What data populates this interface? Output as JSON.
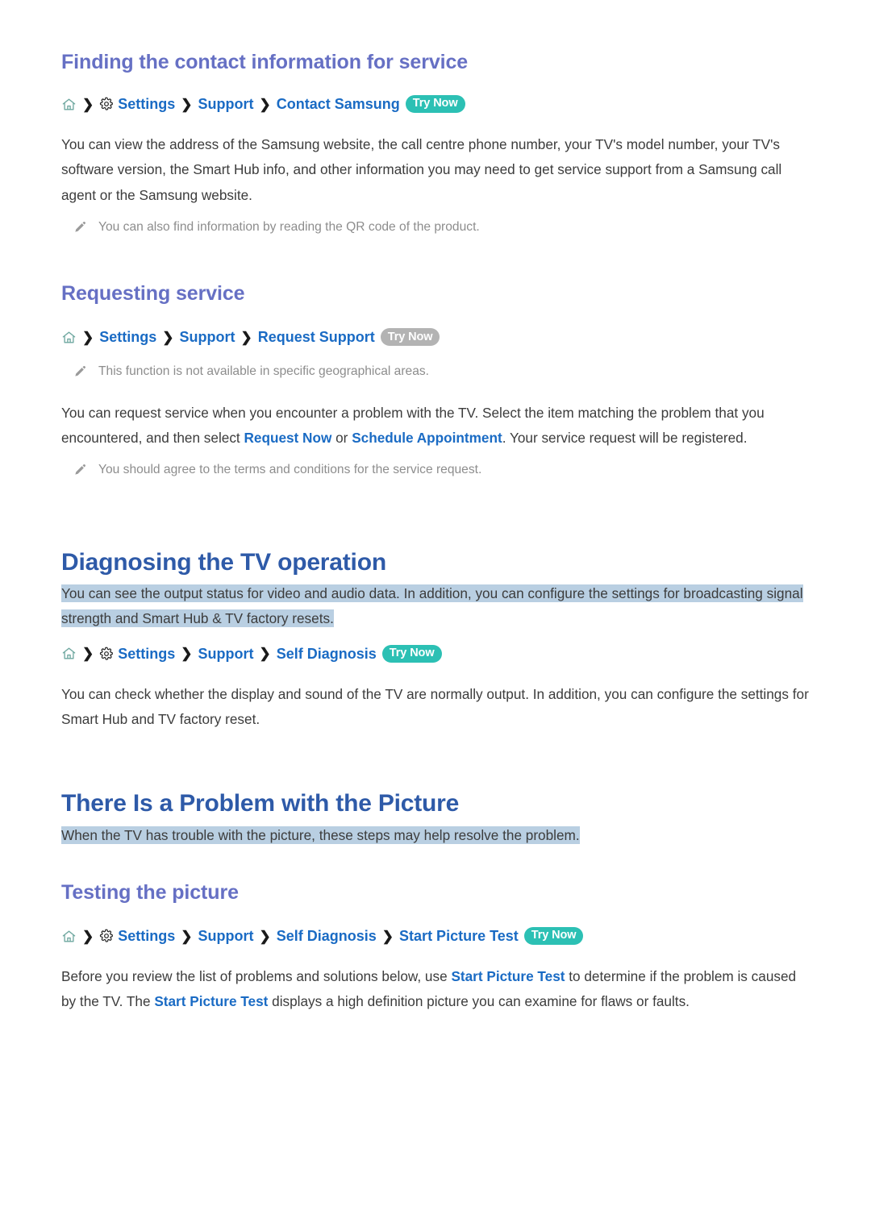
{
  "colors": {
    "h1": "#2e5aa8",
    "h2": "#6670c4",
    "link": "#1a6bc4",
    "body": "#3c3c3c",
    "note": "#8d8d8d",
    "badge_active": "#2cc0b4",
    "badge_disabled": "#b3b3b3",
    "highlight": "#b9cfe2",
    "home_icon": "#6fa8a0",
    "gear_icon": "#222222",
    "pencil_icon": "#9a9a9a",
    "page_background": "#ffffff"
  },
  "sections": [
    {
      "id": "finding-contact-information",
      "heading": "Finding the contact information for service",
      "heading_level": "h2",
      "breadcrumb": {
        "home_icon": "home-icon",
        "gear_icon": "gear-icon",
        "separator": "❯",
        "segments": [
          "Settings",
          "Support",
          "Contact Samsung"
        ],
        "badge": "Try Now",
        "badge_state": "active"
      },
      "paragraph": "You can view the address of the Samsung website, the call centre phone number, your TV's model number, your TV's software version, the Smart Hub info, and other information you may need to get service support from a Samsung call agent or the Samsung website.",
      "note": "You can also find information by reading the QR code of the product."
    },
    {
      "id": "requesting-service",
      "heading": "Requesting service",
      "heading_level": "h2",
      "breadcrumb": {
        "home_icon": "home-icon",
        "gear_icon": null,
        "separator": "❯",
        "segments": [
          "Settings",
          "Support",
          "Request Support"
        ],
        "badge": "Try Now",
        "badge_state": "disabled"
      },
      "note_top": "This function is not available in specific geographical areas.",
      "paragraph_parts": [
        {
          "text": "You can request service when you encounter a problem with the TV. Select the item matching the problem that you encountered, and then select ",
          "style": "plain"
        },
        {
          "text": "Request Now",
          "style": "link"
        },
        {
          "text": " or ",
          "style": "plain"
        },
        {
          "text": "Schedule Appointment",
          "style": "link"
        },
        {
          "text": ". Your service request will be registered.",
          "style": "plain"
        }
      ],
      "note": "You should agree to the terms and conditions for the service request."
    },
    {
      "id": "diagnosing-tv-operation",
      "heading": "Diagnosing the TV operation",
      "heading_level": "h1",
      "highlighted_paragraph": "You can see the output status for video and audio data. In addition, you can configure the settings for broadcasting signal strength and Smart Hub & TV factory resets.",
      "breadcrumb": {
        "home_icon": "home-icon",
        "gear_icon": "gear-icon",
        "separator": "❯",
        "segments": [
          "Settings",
          "Support",
          "Self Diagnosis"
        ],
        "badge": "Try Now",
        "badge_state": "active"
      },
      "paragraph": "You can check whether the display and sound of the TV are normally output. In addition, you can configure the settings for Smart Hub and TV factory reset."
    },
    {
      "id": "problem-with-the-picture",
      "heading": "There Is a Problem with the Picture",
      "heading_level": "h1",
      "highlighted_paragraph": "When the TV has trouble with the picture, these steps may help resolve the problem."
    },
    {
      "id": "testing-the-picture",
      "heading": "Testing the picture",
      "heading_level": "h2",
      "breadcrumb": {
        "home_icon": "home-icon",
        "gear_icon": "gear-icon",
        "separator": "❯",
        "segments": [
          "Settings",
          "Support",
          "Self Diagnosis",
          "Start Picture Test"
        ],
        "badge": "Try Now",
        "badge_state": "active"
      },
      "paragraph_parts": [
        {
          "text": "Before you review the list of problems and solutions below, use ",
          "style": "plain"
        },
        {
          "text": "Start Picture Test",
          "style": "link"
        },
        {
          "text": " to determine if the problem is caused by the TV. The ",
          "style": "plain"
        },
        {
          "text": "Start Picture Test",
          "style": "link"
        },
        {
          "text": " displays a high definition picture you can examine for flaws or faults.",
          "style": "plain"
        }
      ]
    }
  ]
}
